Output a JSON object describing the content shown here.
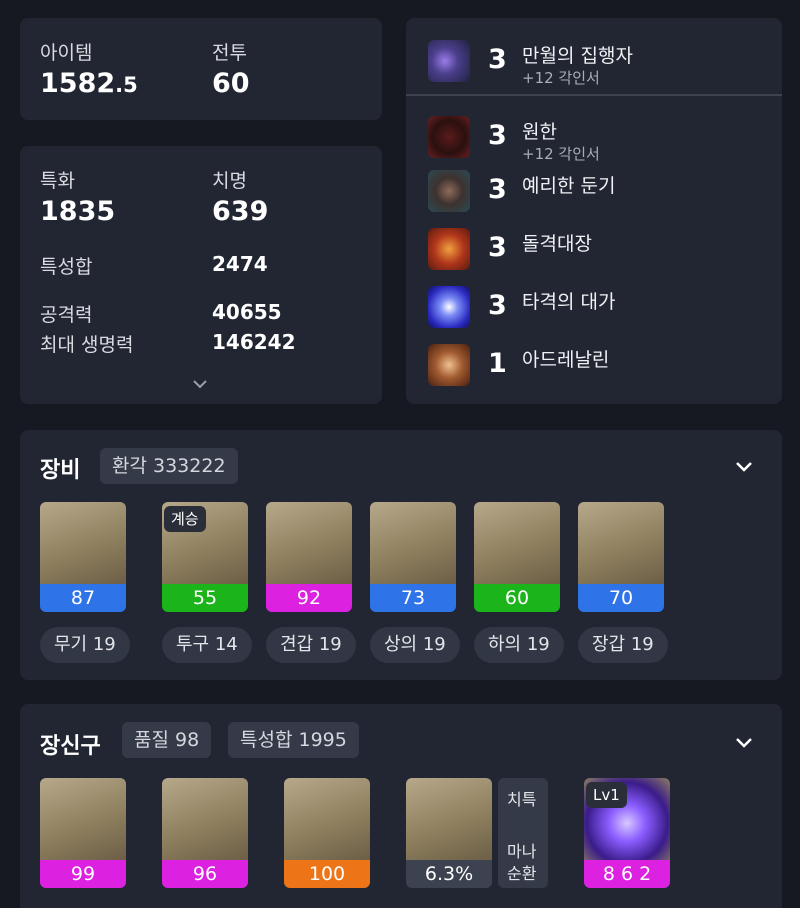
{
  "summary": {
    "item_label": "아이템",
    "item_value": "1582",
    "item_decimal": ".5",
    "combat_label": "전투",
    "combat_value": "60"
  },
  "stats": {
    "spec_label": "특화",
    "spec_value": "1835",
    "crit_label": "치명",
    "crit_value": "639",
    "total_label": "특성합",
    "total_value": "2474",
    "attack_label": "공격력",
    "attack_value": "40655",
    "hp_label": "최대 생명력",
    "hp_value": "146242"
  },
  "engravings": [
    {
      "level": "3",
      "name": "만월의 집행자",
      "sub": "+12 각인서",
      "icon": "moon-executor-icon"
    },
    {
      "level": "3",
      "name": "원한",
      "sub": "+12 각인서",
      "icon": "grudge-icon"
    },
    {
      "level": "3",
      "name": "예리한 둔기",
      "sub": "",
      "icon": "keen-blunt-weapon-icon"
    },
    {
      "level": "3",
      "name": "돌격대장",
      "sub": "",
      "icon": "raid-captain-icon"
    },
    {
      "level": "3",
      "name": "타격의 대가",
      "sub": "",
      "icon": "hit-master-icon"
    },
    {
      "level": "1",
      "name": "아드레날린",
      "sub": "",
      "icon": "adrenaline-icon"
    }
  ],
  "equipment": {
    "title": "장비",
    "chip": "환각 333222",
    "items": [
      {
        "quality": "87",
        "color": "blue",
        "label": "무기 19",
        "tag": "",
        "icon": "weapon-icon"
      },
      {
        "quality": "55",
        "color": "green",
        "label": "투구 14",
        "tag": "계승",
        "icon": "helmet-icon"
      },
      {
        "quality": "92",
        "color": "pink",
        "label": "견갑 19",
        "tag": "",
        "icon": "shoulder-icon"
      },
      {
        "quality": "73",
        "color": "blue",
        "label": "상의 19",
        "tag": "",
        "icon": "chest-armor-icon"
      },
      {
        "quality": "60",
        "color": "green",
        "label": "하의 19",
        "tag": "",
        "icon": "pants-icon"
      },
      {
        "quality": "70",
        "color": "blue",
        "label": "장갑 19",
        "tag": "",
        "icon": "gloves-icon"
      }
    ]
  },
  "accessories": {
    "title": "장신구",
    "chip_quality": "품질 98",
    "chip_total": "특성합 1995",
    "items": [
      {
        "quality": "99",
        "color": "pink",
        "icon": "necklace-icon"
      },
      {
        "quality": "96",
        "color": "pink",
        "icon": "earring-icon"
      },
      {
        "quality": "100",
        "color": "orange",
        "icon": "ring-icon"
      },
      {
        "quality": "6.3%",
        "color": "dark",
        "icon": "bracelet-icon"
      }
    ],
    "bracelet_stat1": "치특",
    "bracelet_stat2": "마나",
    "bracelet_stat3": "순환",
    "stone_tag": "Lv1",
    "stone_value": "8 6 2",
    "stone_color": "pink"
  }
}
